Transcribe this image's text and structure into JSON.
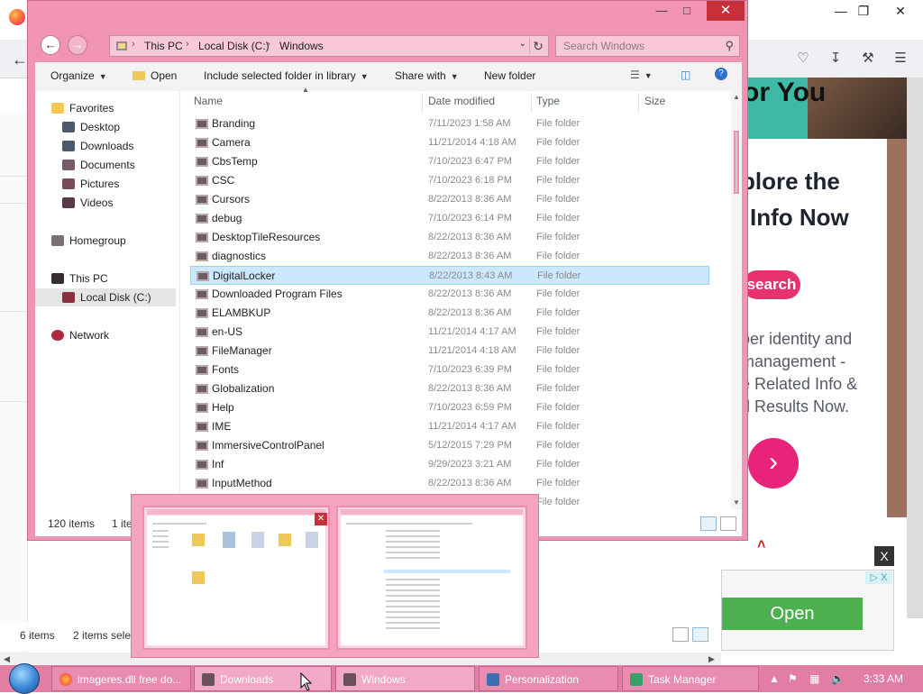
{
  "colors": {
    "explorer_frame": "#f093b4",
    "selection": "#cce8ff",
    "taskbar": "#e27ea3",
    "ad_accent": "#e8326e"
  },
  "browser": {
    "ad": {
      "banner_text": "or You",
      "heading_line1": "plore the",
      "heading_line2": "Info Now",
      "search_label": "search",
      "body_lines": [
        "ber identity and",
        "management -",
        "e Related Info &",
        "d Results Now."
      ],
      "close_label": "X",
      "ad_choice_label": "▷ X",
      "open_label": "Open"
    }
  },
  "explorer": {
    "address": {
      "crumbs": [
        "This PC",
        "Local Disk (C:)",
        "Windows"
      ]
    },
    "search_placeholder": "Search Windows",
    "commands": {
      "organize": "Organize",
      "open": "Open",
      "include_in_library": "Include selected folder in library",
      "share_with": "Share with",
      "new_folder": "New folder"
    },
    "nav": {
      "favorites": "Favorites",
      "desktop": "Desktop",
      "downloads": "Downloads",
      "documents": "Documents",
      "pictures": "Pictures",
      "videos": "Videos",
      "homegroup": "Homegroup",
      "this_pc": "This PC",
      "local_disk": "Local Disk (C:)",
      "network": "Network"
    },
    "columns": {
      "name": "Name",
      "date_modified": "Date modified",
      "type": "Type",
      "size": "Size"
    },
    "files": [
      {
        "name": "Branding",
        "date": "7/11/2023 1:58 AM",
        "type": "File folder"
      },
      {
        "name": "Camera",
        "date": "11/21/2014 4:18 AM",
        "type": "File folder"
      },
      {
        "name": "CbsTemp",
        "date": "7/10/2023 6:47 PM",
        "type": "File folder"
      },
      {
        "name": "CSC",
        "date": "7/10/2023 6:18 PM",
        "type": "File folder"
      },
      {
        "name": "Cursors",
        "date": "8/22/2013 8:36 AM",
        "type": "File folder"
      },
      {
        "name": "debug",
        "date": "7/10/2023 6:14 PM",
        "type": "File folder"
      },
      {
        "name": "DesktopTileResources",
        "date": "8/22/2013 8:36 AM",
        "type": "File folder"
      },
      {
        "name": "diagnostics",
        "date": "8/22/2013 8:36 AM",
        "type": "File folder"
      },
      {
        "name": "DigitalLocker",
        "date": "8/22/2013 8:43 AM",
        "type": "File folder"
      },
      {
        "name": "Downloaded Program Files",
        "date": "8/22/2013 8:36 AM",
        "type": "File folder"
      },
      {
        "name": "ELAMBKUP",
        "date": "8/22/2013 8:36 AM",
        "type": "File folder"
      },
      {
        "name": "en-US",
        "date": "11/21/2014 4:17 AM",
        "type": "File folder"
      },
      {
        "name": "FileManager",
        "date": "11/21/2014 4:18 AM",
        "type": "File folder"
      },
      {
        "name": "Fonts",
        "date": "7/10/2023 6:39 PM",
        "type": "File folder"
      },
      {
        "name": "Globalization",
        "date": "8/22/2013 8:36 AM",
        "type": "File folder"
      },
      {
        "name": "Help",
        "date": "7/10/2023 6:59 PM",
        "type": "File folder"
      },
      {
        "name": "IME",
        "date": "11/21/2014 4:17 AM",
        "type": "File folder"
      },
      {
        "name": "ImmersiveControlPanel",
        "date": "5/12/2015 7:29 PM",
        "type": "File folder"
      },
      {
        "name": "Inf",
        "date": "9/29/2023 3:21 AM",
        "type": "File folder"
      },
      {
        "name": "InputMethod",
        "date": "8/22/2013 8:36 AM",
        "type": "File folder"
      },
      {
        "name": "",
        "date": "",
        "type": "File folder"
      }
    ],
    "selected_file": "DigitalLocker",
    "status": {
      "count": "120 items",
      "selected": "1 ite"
    }
  },
  "downloads_window": {
    "status": {
      "count": "6 items",
      "selected": "2 items selec"
    }
  },
  "taskbar": {
    "buttons": [
      {
        "label": "imageres.dll free do...",
        "icon": "firefox-icon"
      },
      {
        "label": "Downloads",
        "icon": "folder-icon"
      },
      {
        "label": "Windows",
        "icon": "folder-icon"
      },
      {
        "label": "Personalization",
        "icon": "control-panel-icon"
      },
      {
        "label": "Task Manager",
        "icon": "task-manager-icon"
      }
    ],
    "clock": "3:33 AM"
  }
}
